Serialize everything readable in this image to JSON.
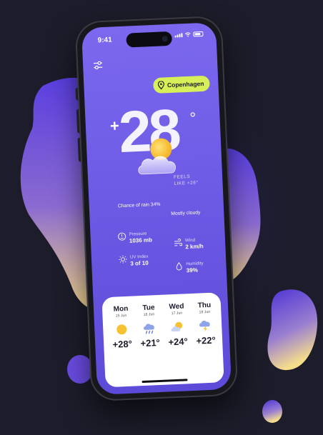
{
  "status": {
    "time": "9:41"
  },
  "location": {
    "city": "Copenhagen"
  },
  "current": {
    "temp_sign": "+",
    "temp_value": "28",
    "temp_unit": "°",
    "feels_like_label": "FEELS",
    "feels_like_value": "LIKE +26°",
    "chance_of_rain": "Chance of rain 34%",
    "condition": "Mostly cloudy"
  },
  "stats": {
    "pressure_label": "Pressure",
    "pressure_value": "1036 mb",
    "wind_label": "Wind",
    "wind_value": "2 km/h",
    "uv_label": "UV Index",
    "uv_value": "3 of 10",
    "humidity_label": "Humidity",
    "humidity_value": "39%"
  },
  "forecast": [
    {
      "day": "Mon",
      "date": "15 Jun",
      "temp": "+28°",
      "icon": "sun-icon"
    },
    {
      "day": "Tue",
      "date": "16 Jun",
      "temp": "+21°",
      "icon": "rain-cloud-icon"
    },
    {
      "day": "Wed",
      "date": "17 Jun",
      "temp": "+24°",
      "icon": "partly-cloudy-icon"
    },
    {
      "day": "Thu",
      "date": "18 Jun",
      "temp": "+22°",
      "icon": "thunderstorm-icon"
    }
  ],
  "colors": {
    "screen_gradient_top": "#7b68ee",
    "accent_pill": "#d7f05a",
    "page_background": "#1c1c2a"
  }
}
